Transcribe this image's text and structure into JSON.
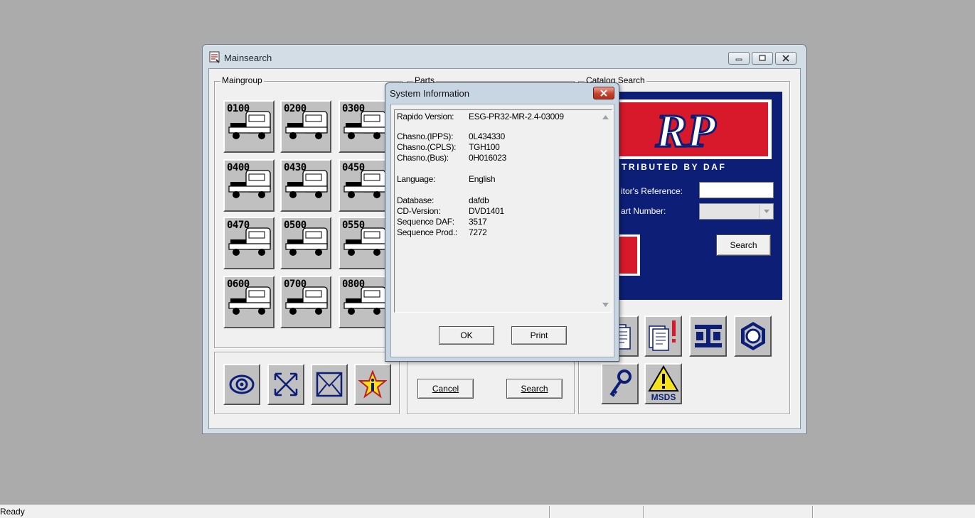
{
  "main_window": {
    "title": "Mainsearch",
    "maingroup_legend": "Maingroup",
    "parts_legend": "Parts",
    "catalog_legend": "Catalog Search",
    "tiles": [
      {
        "code": "0100"
      },
      {
        "code": "0200"
      },
      {
        "code": "0300"
      },
      {
        "code": "0400"
      },
      {
        "code": "0430"
      },
      {
        "code": "0450"
      },
      {
        "code": "0470"
      },
      {
        "code": "0500"
      },
      {
        "code": "0550"
      },
      {
        "code": "0600"
      },
      {
        "code": "0700"
      },
      {
        "code": "0800"
      }
    ],
    "bottom_icons": [
      "eye-icon",
      "expand-arrows-icon",
      "envelope-icon",
      "info-star-icon"
    ],
    "parts_buttons": {
      "cancel": "Cancel",
      "search": "Search"
    },
    "catalog": {
      "brand_text": "RP",
      "distributed_by": "TRIBUTED BY DAF",
      "competitor_ref_label": "itor's Reference:",
      "part_number_label": "art Number:",
      "competitor_ref_value": "",
      "part_number_value": "",
      "search_button": "Search",
      "colors": {
        "panel": "#0c1e76",
        "accent": "#d7192b"
      }
    },
    "tool_icons": [
      "documents-icon",
      "documents-alert-icon",
      "beam-icon",
      "nut-icon",
      "key-icon",
      "msds-warning-icon"
    ],
    "msds_label": "MSDS"
  },
  "dialog": {
    "title": "System Information",
    "rows": [
      {
        "k": "Rapido Version:",
        "v": "ESG-PR32-MR-2.4-03009"
      },
      {
        "k": "Chasno.(IPPS):",
        "v": "0L434330"
      },
      {
        "k": "Chasno.(CPLS):",
        "v": "TGH100"
      },
      {
        "k": "Chasno.(Bus):",
        "v": "0H016023"
      },
      {
        "k": "Language:",
        "v": "English"
      },
      {
        "k": "Database:",
        "v": "dafdb"
      },
      {
        "k": "CD-Version:",
        "v": "DVD1401"
      },
      {
        "k": "Sequence DAF:",
        "v": "3517"
      },
      {
        "k": "Sequence Prod.:",
        "v": "7272"
      }
    ],
    "ok_button": "OK",
    "print_button": "Print"
  },
  "status_bar": {
    "text": "Ready"
  }
}
